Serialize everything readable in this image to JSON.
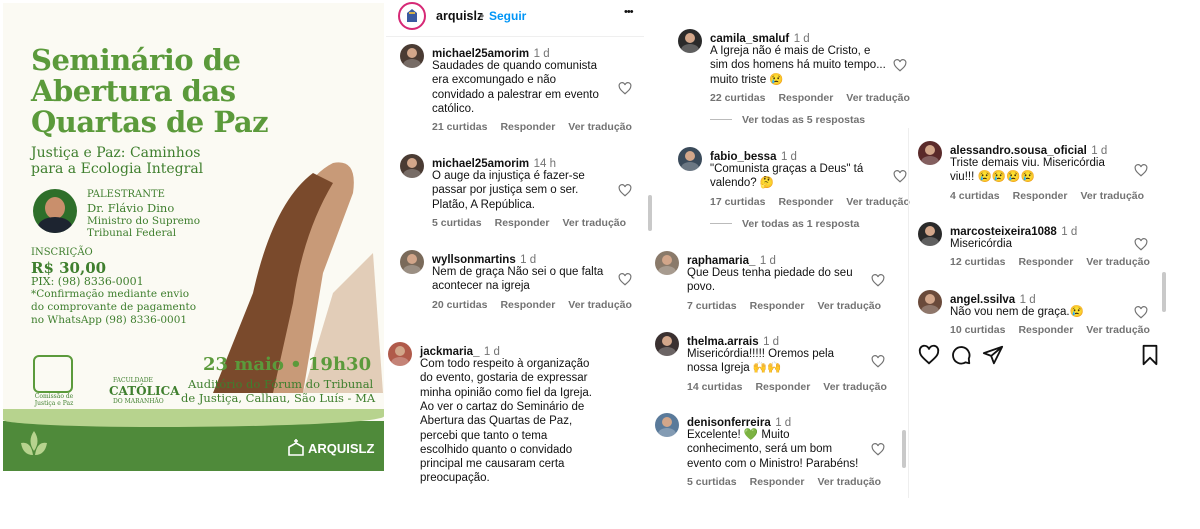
{
  "poster": {
    "title": "Seminário de Abertura das Quartas de Paz",
    "subtitle": "Justiça e Paz: Caminhos para a Ecologia Integral",
    "speaker_label": "PALESTRANTE",
    "speaker_name": "Dr. Flávio Dino",
    "speaker_role1": "Ministro do Supremo",
    "speaker_role2": "Tribunal Federal",
    "registration_label": "INSCRIÇÃO",
    "price": "R$ 30,00",
    "pix": "PIX: (98) 8336-0001",
    "note1": "*Confirmação mediante envio",
    "note2": "do comprovante de pagamento",
    "note3": "no WhatsApp (98) 8336-0001",
    "date": "23 maio • 19h30",
    "place1": "Auditório do Fórum do Tribunal",
    "place2": "de Justiça, Calhau, São Luís - MA",
    "logo1_text": "Comissão de Justiça e Paz",
    "logo2_line1": "FACULDADE",
    "logo2_line2": "CATÓLICA",
    "logo2_line3": "DO MARANHÃO",
    "brand": "ARQUISLZ"
  },
  "header": {
    "username": "arquislz",
    "follow": "Seguir",
    "more": "•••"
  },
  "comments_col1": [
    {
      "user": "michael25amorim",
      "time": "1 d",
      "lines": [
        "Saudades de quando comunista",
        "era excomungado e não",
        "convidado a palestrar em evento",
        "católico."
      ],
      "likes": "21 curtidas",
      "reply": "Responder",
      "translate": "Ver tradução"
    },
    {
      "user": "michael25amorim",
      "time": "14 h",
      "lines": [
        "O auge da injustiça é fazer-se",
        "passar por justiça sem o ser.",
        "Platão, A República."
      ],
      "likes": "5 curtidas",
      "reply": "Responder",
      "translate": "Ver tradução"
    },
    {
      "user": "wyllsonmartins",
      "time": "1 d",
      "lines": [
        "Nem de graça Não sei o que falta",
        "acontecer na igreja"
      ],
      "likes": "20 curtidas",
      "reply": "Responder",
      "translate": "Ver tradução"
    },
    {
      "user": "jackmaria_",
      "time": "1 d",
      "lines": [
        "Com todo respeito à organização",
        "do evento, gostaria de expressar",
        "minha opinião como fiel da Igreja.",
        "Ao ver o cartaz do Seminário de",
        "Abertura das Quartas de Paz,",
        "percebi que tanto o tema",
        "escolhido quanto o convidado",
        "principal me causaram certa",
        "preocupação."
      ]
    }
  ],
  "comments_col2": [
    {
      "user": "camila_smaluf",
      "time": "1 d",
      "lines": [
        "A Igreja não é mais de Cristo, e",
        "sim dos homens há muito tempo...",
        "muito triste 😢"
      ],
      "likes": "22 curtidas",
      "reply": "Responder",
      "translate": "Ver tradução",
      "replies": "Ver todas as 5 respostas"
    },
    {
      "user": "fabio_bessa",
      "time": "1 d",
      "lines": [
        "\"Comunista graças a Deus\" tá",
        "valendo? 🤔"
      ],
      "likes": "17 curtidas",
      "reply": "Responder",
      "translate": "Ver tradução",
      "replies": "Ver todas as 1 resposta"
    },
    {
      "user": "raphamaria_",
      "time": "1 d",
      "lines": [
        "Que Deus tenha piedade do seu",
        "povo."
      ],
      "likes": "7 curtidas",
      "reply": "Responder",
      "translate": "Ver tradução"
    },
    {
      "user": "thelma.arrais",
      "time": "1 d",
      "lines": [
        "Misericórdia!!!!! Oremos pela",
        "nossa Igreja 🙌🙌"
      ],
      "likes": "14 curtidas",
      "reply": "Responder",
      "translate": "Ver tradução"
    },
    {
      "user": "denisonferreira",
      "time": "1 d",
      "lines": [
        "Excelente! 💚 Muito",
        "conhecimento, será um bom",
        "evento com o Ministro! Parabéns!"
      ],
      "likes": "5 curtidas",
      "reply": "Responder",
      "translate": "Ver tradução"
    }
  ],
  "comments_col3": [
    {
      "user": "alessandro.sousa_oficial",
      "time": "1 d",
      "lines": [
        "Triste demais viu. Misericórdia",
        "viu!!! 😢😢😢😢"
      ],
      "likes": "4 curtidas",
      "reply": "Responder",
      "translate": "Ver tradução"
    },
    {
      "user": "marcosteixeira1088",
      "time": "1 d",
      "lines": [
        "Misericórdia"
      ],
      "likes": "12 curtidas",
      "reply": "Responder",
      "translate": "Ver tradução"
    },
    {
      "user": "angel.ssilva",
      "time": "1 d",
      "lines": [
        "Não vou nem de graça.😢"
      ],
      "likes": "10 curtidas",
      "reply": "Responder",
      "translate": "Ver tradução"
    }
  ],
  "colors": {
    "accent": "#0095f6",
    "green": "#5b9a3b",
    "muted": "#737373"
  }
}
